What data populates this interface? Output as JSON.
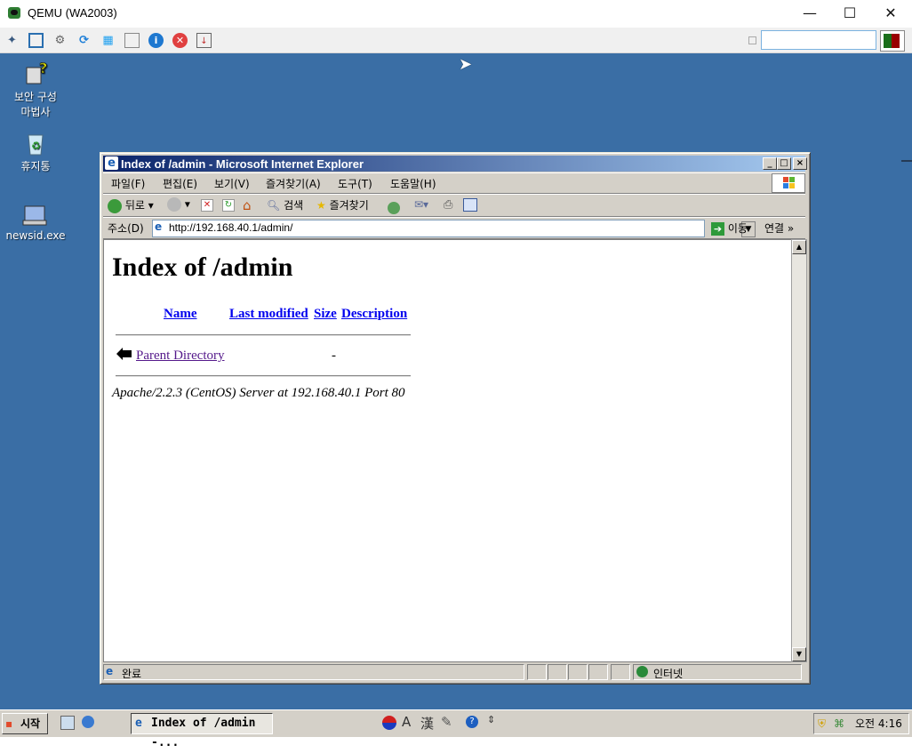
{
  "qemu": {
    "title": "QEMU (WA2003)",
    "controls": {
      "minimize": "—",
      "maximize": "☐",
      "close": "✕"
    },
    "toolbar_icons": [
      "gear-cube-icon",
      "fullscreen-icon",
      "settings-icon",
      "refresh-icon",
      "windows-icon",
      "drive-icon",
      "info-icon",
      "stop-icon",
      "screenshot-icon"
    ],
    "search_value": ""
  },
  "desktop": {
    "icons": [
      {
        "label": "보안 구성\n마법사",
        "icon": "security-wizard-icon"
      },
      {
        "label": "휴지통",
        "icon": "recycle-bin-icon"
      },
      {
        "label": "newsid.exe",
        "icon": "newsid-icon"
      }
    ]
  },
  "ie": {
    "title": "Index of /admin - Microsoft Internet Explorer",
    "menu": [
      "파일(F)",
      "편집(E)",
      "보기(V)",
      "즐겨찾기(A)",
      "도구(T)",
      "도움말(H)"
    ],
    "toolbar": {
      "back": "뒤로",
      "search": "검색",
      "favorites": "즐겨찾기"
    },
    "address_label": "주소(D)",
    "address_value": "http://192.168.40.1/admin/",
    "go_label": "이동",
    "links_label": "연결",
    "status_text": "완료",
    "zone_text": "인터넷"
  },
  "page": {
    "heading": "Index of /admin",
    "columns": [
      "Name",
      "Last modified",
      "Size",
      "Description"
    ],
    "rows": [
      {
        "name": "Parent Directory",
        "size": "-"
      }
    ],
    "footer": "Apache/2.2.3 (CentOS) Server at 192.168.40.1 Port 80"
  },
  "taskbar": {
    "start_label": "시작",
    "task_label": "Index of /admin -...",
    "clock": "오전 4:16"
  },
  "colors": {
    "desktop": "#3a6ea5",
    "titlebar_start": "#0a246a",
    "titlebar_end": "#a6caf0",
    "link": "#0000ee",
    "visited": "#551a8b"
  }
}
